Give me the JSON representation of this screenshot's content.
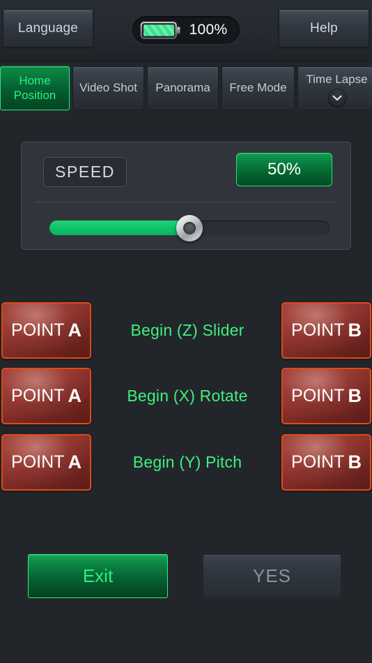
{
  "header": {
    "language_label": "Language",
    "help_label": "Help",
    "battery": {
      "percent_label": "100%",
      "level": 100,
      "icon": "battery-full-icon",
      "color": "#3fe08a"
    }
  },
  "tabs": [
    {
      "label": "Home Position",
      "line1": "Home",
      "line2": "Position",
      "active": true
    },
    {
      "label": "Video Shot",
      "line1": "Video Shot",
      "line2": "",
      "active": false
    },
    {
      "label": "Panorama",
      "line1": "Panorama",
      "line2": "",
      "active": false
    },
    {
      "label": "Free Mode",
      "line1": "Free Mode",
      "line2": "",
      "active": false
    },
    {
      "label": "Time Lapse",
      "line1": "Time Lapse",
      "line2": "",
      "active": false,
      "icon": "chevron-down-icon"
    }
  ],
  "speed_panel": {
    "tag_label": "SPEED",
    "value_label": "50%",
    "slider_percent": 50,
    "accent_color": "#0fc468"
  },
  "point_rows": [
    {
      "point_a_label": "POINT",
      "point_a_letter": "A",
      "title": "Begin (Z) Slider",
      "point_b_label": "POINT",
      "point_b_letter": "B"
    },
    {
      "point_a_label": "POINT",
      "point_a_letter": "A",
      "title": "Begin (X) Rotate",
      "point_b_label": "POINT",
      "point_b_letter": "B"
    },
    {
      "point_a_label": "POINT",
      "point_a_letter": "A",
      "title": "Begin (Y) Pitch",
      "point_b_label": "POINT",
      "point_b_letter": "B"
    }
  ],
  "footer": {
    "exit_label": "Exit",
    "yes_label": "YES"
  },
  "colors": {
    "background": "#22262b",
    "green_accent": "#2bf07e",
    "red_button_border": "#e04a14",
    "text_muted": "#8d939b"
  }
}
